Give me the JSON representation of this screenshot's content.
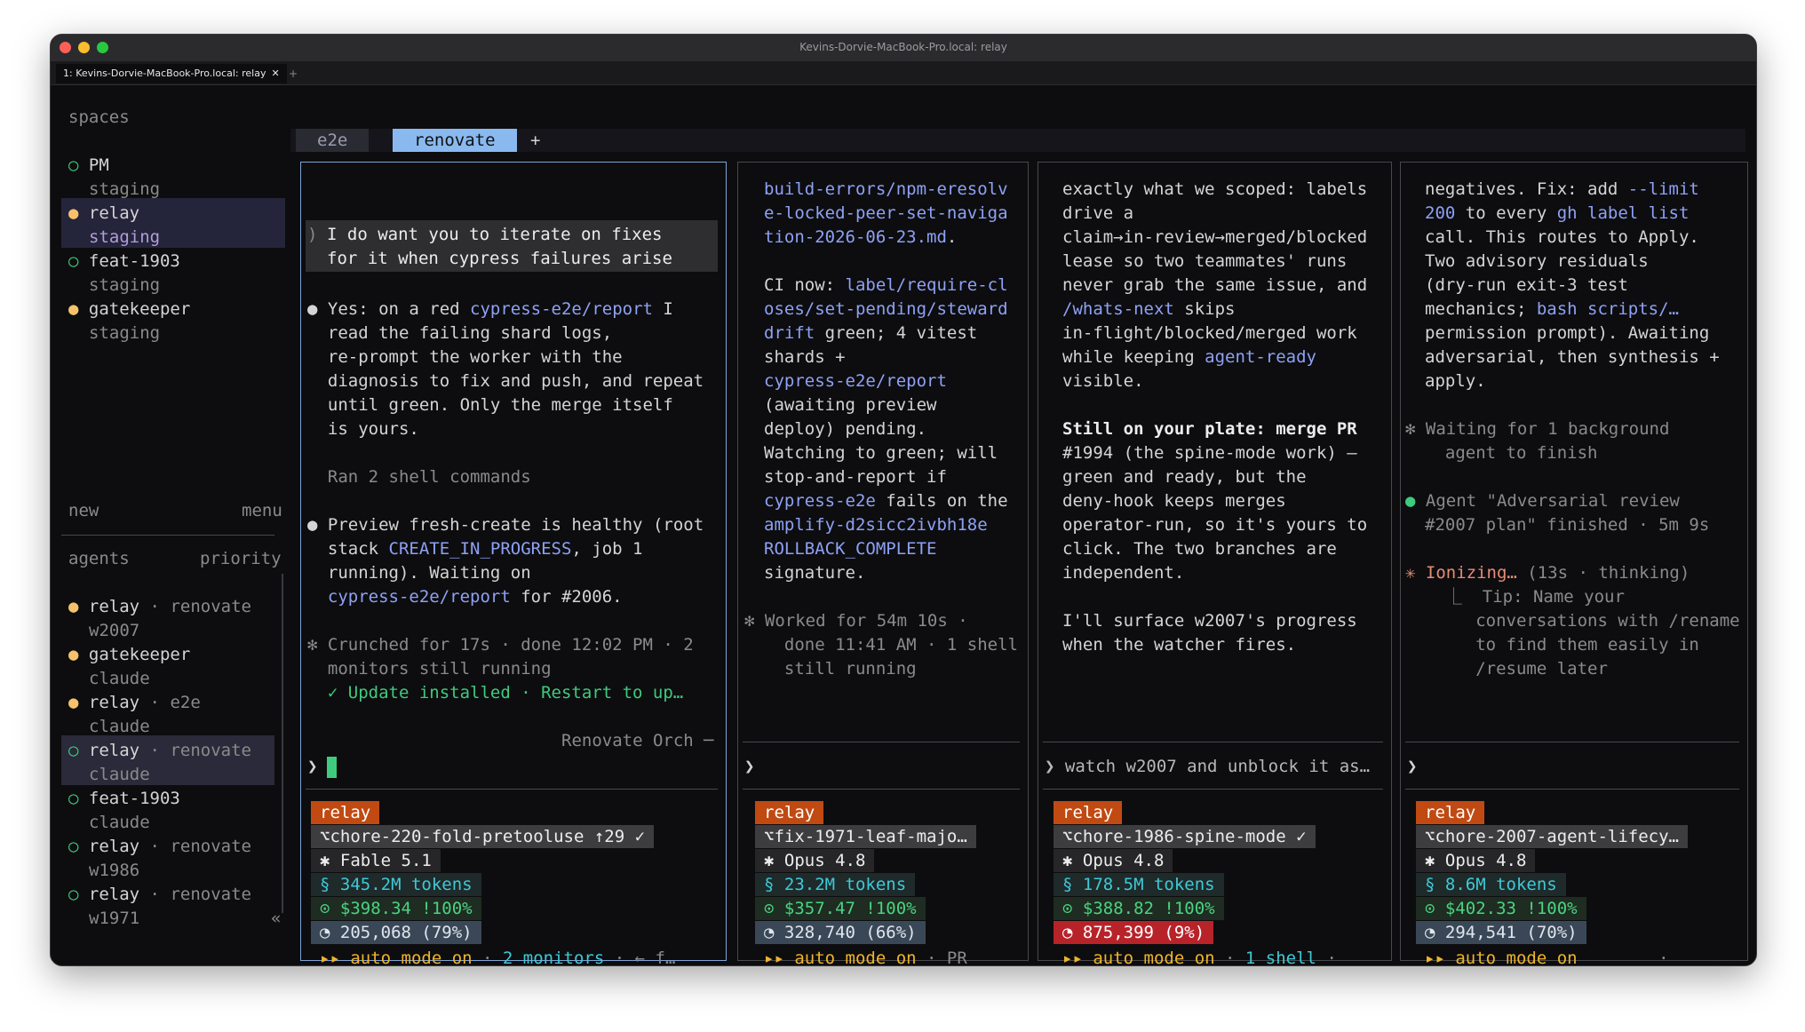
{
  "window": {
    "title": "Kevins-Dorvie-MacBook-Pro.local: relay"
  },
  "terminal_tab": {
    "label": "1: Kevins-Dorvie-MacBook-Pro.local: relay",
    "close": "✕",
    "new": "+"
  },
  "sidebar": {
    "spaces_header": "spaces",
    "spaces": [
      {
        "dot": "○",
        "name": "PM",
        "sub": "staging"
      },
      {
        "dot": "●",
        "name": "relay",
        "sub": "staging"
      },
      {
        "dot": "○",
        "name": "feat-1903",
        "sub": "staging"
      },
      {
        "dot": "●",
        "name": "gatekeeper",
        "sub": "staging"
      }
    ],
    "new_label": "new",
    "menu_label": "menu",
    "agents_header": "agents",
    "priority_label": "priority",
    "agents": [
      {
        "dot": "●",
        "name": "relay",
        "sep": " · ",
        "space": "renovate",
        "sub": "w2007"
      },
      {
        "dot": "●",
        "name": "gatekeeper",
        "sep": "",
        "space": "",
        "sub": "claude"
      },
      {
        "dot": "●",
        "name": "relay",
        "sep": " · ",
        "space": "e2e",
        "sub": "claude"
      },
      {
        "dot": "○",
        "name": "relay",
        "sep": " · ",
        "space": "renovate",
        "sub": "claude"
      },
      {
        "dot": "○",
        "name": "feat-1903",
        "sep": "",
        "space": "",
        "sub": "claude"
      },
      {
        "dot": "○",
        "name": "relay",
        "sep": " · ",
        "space": "renovate",
        "sub": "w1986"
      },
      {
        "dot": "○",
        "name": "relay",
        "sep": " · ",
        "space": "renovate",
        "sub": "w1971"
      }
    ],
    "collapse": "«"
  },
  "space_tabs": [
    {
      "label": "e2e"
    },
    {
      "label": "renovate"
    }
  ],
  "space_tab_add": "+",
  "panes": [
    {
      "lines": [
        [
          "",
          "",
          ""
        ],
        [
          "",
          ")",
          "dim"
        ],
        [
          "I do want you to iterate on fixes"
        ],
        [
          "for it when cypress failures arise"
        ]
      ],
      "body": [
        [
          {
            "t": "● ",
            "c": ""
          },
          {
            "t": "Yes: on a red ",
            "c": ""
          },
          {
            "t": "cypress-e2e/report",
            "c": "lnk"
          },
          {
            "t": " I",
            "c": ""
          }
        ],
        [
          {
            "t": "  read the failing shard logs,",
            "c": ""
          }
        ],
        [
          {
            "t": "  re-prompt the worker with the",
            "c": ""
          }
        ],
        [
          {
            "t": "  diagnosis to fix and push, and repeat",
            "c": ""
          }
        ],
        [
          {
            "t": "  until green. Only the merge itself",
            "c": ""
          }
        ],
        [
          {
            "t": "  is yours.",
            "c": ""
          }
        ],
        [
          {
            "t": "",
            "c": ""
          }
        ],
        [
          {
            "t": "  Ran 2 shell commands",
            "c": "dim"
          }
        ],
        [
          {
            "t": "",
            "c": ""
          }
        ],
        [
          {
            "t": "● ",
            "c": ""
          },
          {
            "t": "Preview fresh-create is healthy (root",
            "c": ""
          }
        ],
        [
          {
            "t": "  stack ",
            "c": ""
          },
          {
            "t": "CREATE_IN_PROGRESS",
            "c": "lnk"
          },
          {
            "t": ", job 1",
            "c": ""
          }
        ],
        [
          {
            "t": "  running). Waiting on",
            "c": ""
          }
        ],
        [
          {
            "t": "  ",
            "c": ""
          },
          {
            "t": "cypress-e2e/report",
            "c": "lnk"
          },
          {
            "t": " for #2006.",
            "c": ""
          }
        ],
        [
          {
            "t": "",
            "c": ""
          }
        ],
        [
          {
            "t": "✻ Crunched for 17s · done 12:02 PM · 2",
            "c": "dim"
          }
        ],
        [
          {
            "t": "  monitors still running",
            "c": "dim"
          }
        ],
        [
          {
            "t": "  ✓ Update installed · Restart to up…",
            "c": "grn"
          }
        ]
      ],
      "footer_label": "Renovate Orch ─",
      "prompt": "❯",
      "relay": "relay",
      "branch": "⌥chore-220-fold-pretooluse ↑29 ✓",
      "model": "✱ Fable 5.1",
      "tokens": "§ 345.2M tokens",
      "cost": "⊙ $398.34 !100%",
      "ctx": "◔ 205,068 (79%)",
      "status": [
        {
          "t": "▸▸ auto mode on",
          "c": "yel"
        },
        {
          "t": " · ",
          "c": "dim"
        },
        {
          "t": "2 monitors",
          "c": "cyan"
        },
        {
          "t": " · ← f…",
          "c": "dim"
        }
      ]
    },
    {
      "body": [
        [
          {
            "t": "build-errors/npm-eresolv",
            "c": "lnk"
          }
        ],
        [
          {
            "t": "e-locked-peer-set-naviga",
            "c": "lnk"
          }
        ],
        [
          {
            "t": "tion-2026-06-23.md",
            "c": "lnk"
          },
          {
            "t": ".",
            "c": ""
          }
        ],
        [
          {
            "t": "",
            "c": ""
          }
        ],
        [
          {
            "t": "CI now: ",
            "c": ""
          },
          {
            "t": "label/require-cl",
            "c": "lnk"
          }
        ],
        [
          {
            "t": "oses/set-pending/steward",
            "c": "lnk"
          }
        ],
        [
          {
            "t": "drift",
            "c": "lnk"
          },
          {
            "t": " green; 4 vitest",
            "c": ""
          }
        ],
        [
          {
            "t": "shards +",
            "c": ""
          }
        ],
        [
          {
            "t": "cypress-e2e/report",
            "c": "lnk"
          }
        ],
        [
          {
            "t": "(awaiting preview",
            "c": ""
          }
        ],
        [
          {
            "t": "deploy) pending.",
            "c": ""
          }
        ],
        [
          {
            "t": "Watching to green; will",
            "c": ""
          }
        ],
        [
          {
            "t": "stop-and-report if",
            "c": ""
          }
        ],
        [
          {
            "t": "cypress-e2e",
            "c": "lnk"
          },
          {
            "t": " fails on the",
            "c": ""
          }
        ],
        [
          {
            "t": "amplify-d2sicc2ivbh18e",
            "c": "lnk"
          }
        ],
        [
          {
            "t": "ROLLBACK_COMPLETE",
            "c": "lnk"
          }
        ],
        [
          {
            "t": "signature.",
            "c": ""
          }
        ],
        [
          {
            "t": "",
            "c": ""
          }
        ],
        [
          {
            "t": "✻ Worked for 54m 10s ·",
            "c": "dim"
          }
        ],
        [
          {
            "t": "  done 11:41 AM · 1 shell",
            "c": "dim"
          }
        ],
        [
          {
            "t": "  still running",
            "c": "dim"
          }
        ]
      ],
      "prompt": "❯",
      "relay": "relay",
      "branch": "⌥fix-1971-leaf-majo…",
      "model": "✱ Opus 4.8",
      "tokens": "§ 23.2M tokens",
      "cost": "⊙ $357.47 !100%",
      "ctx": "◔ 328,740 (66%)",
      "status": [
        {
          "t": "▸▸ auto mode on",
          "c": "yel"
        },
        {
          "t": " · PR",
          "c": "dim"
        }
      ]
    },
    {
      "body": [
        [
          {
            "t": "exactly what we scoped: labels",
            "c": ""
          }
        ],
        [
          {
            "t": "drive a",
            "c": ""
          }
        ],
        [
          {
            "t": "claim→in-review→merged/blocked",
            "c": ""
          }
        ],
        [
          {
            "t": "lease so two teammates' runs",
            "c": ""
          }
        ],
        [
          {
            "t": "never grab the same issue, and",
            "c": ""
          }
        ],
        [
          {
            "t": "/whats-next",
            "c": "lnk"
          },
          {
            "t": " skips",
            "c": ""
          }
        ],
        [
          {
            "t": "in-flight/blocked/merged work",
            "c": ""
          }
        ],
        [
          {
            "t": "while keeping ",
            "c": ""
          },
          {
            "t": "agent-ready",
            "c": "lnk"
          }
        ],
        [
          {
            "t": "visible.",
            "c": ""
          }
        ],
        [
          {
            "t": "",
            "c": ""
          }
        ],
        [
          {
            "t": "Still on your plate:",
            "c": "bold"
          },
          {
            "t": " merge PR",
            "c": "bold"
          }
        ],
        [
          {
            "t": "#1994 (the spine-mode work) —",
            "c": ""
          }
        ],
        [
          {
            "t": "green and ready, but the",
            "c": ""
          }
        ],
        [
          {
            "t": "deny-hook keeps merges",
            "c": ""
          }
        ],
        [
          {
            "t": "operator-run, so it's yours to",
            "c": ""
          }
        ],
        [
          {
            "t": "click. The two branches are",
            "c": ""
          }
        ],
        [
          {
            "t": "independent.",
            "c": ""
          }
        ],
        [
          {
            "t": "",
            "c": ""
          }
        ],
        [
          {
            "t": "I'll surface w2007's progress",
            "c": ""
          }
        ],
        [
          {
            "t": "when the watcher fires.",
            "c": ""
          }
        ]
      ],
      "prompt": "❯ watch w2007 and unblock it as…",
      "relay": "relay",
      "branch": "⌥chore-1986-spine-mode ✓",
      "model": "✱ Opus 4.8",
      "tokens": "§ 178.5M tokens",
      "cost": "⊙ $388.82 !100%",
      "ctx": "◔ 875,399 (9%)",
      "status": [
        {
          "t": "▸▸ auto mode on",
          "c": "yel"
        },
        {
          "t": " · ",
          "c": "dim"
        },
        {
          "t": "1 shell",
          "c": "cyan"
        },
        {
          "t": " ·",
          "c": "dim"
        }
      ]
    },
    {
      "body": [
        [
          {
            "t": "negatives. Fix: add ",
            "c": ""
          },
          {
            "t": "--limit",
            "c": "lnk"
          }
        ],
        [
          {
            "t": "200",
            "c": "lnk"
          },
          {
            "t": " to every ",
            "c": ""
          },
          {
            "t": "gh label list",
            "c": "lnk"
          }
        ],
        [
          {
            "t": "call. This routes to Apply.",
            "c": ""
          }
        ],
        [
          {
            "t": "Two advisory residuals",
            "c": ""
          }
        ],
        [
          {
            "t": "(dry-run exit-3 test",
            "c": ""
          }
        ],
        [
          {
            "t": "mechanics; ",
            "c": ""
          },
          {
            "t": "bash scripts/…",
            "c": "lnk"
          }
        ],
        [
          {
            "t": "permission prompt). Awaiting",
            "c": ""
          }
        ],
        [
          {
            "t": "adversarial, then synthesis +",
            "c": ""
          }
        ],
        [
          {
            "t": "apply.",
            "c": ""
          }
        ],
        [
          {
            "t": "",
            "c": ""
          }
        ],
        [
          {
            "t": "✻ Waiting for 1 background",
            "c": "dim"
          }
        ],
        [
          {
            "t": "  agent to finish",
            "c": "dim"
          }
        ],
        [
          {
            "t": "",
            "c": ""
          }
        ],
        [
          {
            "t": "● ",
            "c": "grn"
          },
          {
            "t": "Agent \"Adversarial review",
            "c": "dim"
          }
        ],
        [
          {
            "t": "#2007 plan\" finished · 5m 9s",
            "c": "dim"
          }
        ],
        [
          {
            "t": "",
            "c": ""
          }
        ],
        [
          {
            "t": "✳ Ionizing… ",
            "c": "pink"
          },
          {
            "t": "(13s · thinking)",
            "c": "dim"
          }
        ],
        [
          {
            "t": "  ⎿  Tip: Name your",
            "c": "dim"
          }
        ],
        [
          {
            "t": "     conversations with /rename",
            "c": "dim"
          }
        ],
        [
          {
            "t": "     to find them easily in",
            "c": "dim"
          }
        ],
        [
          {
            "t": "     /resume later",
            "c": "dim"
          }
        ]
      ],
      "prompt": "❯",
      "relay": "relay",
      "branch": "⌥chore-2007-agent-lifecy…",
      "model": "✱ Opus 4.8",
      "tokens": "§ 8.6M tokens",
      "cost": "⊙ $402.33 !100%",
      "ctx": "◔ 294,541 (70%)",
      "status": [
        {
          "t": "▸▸ auto mode on",
          "c": "yel"
        },
        {
          "t": "        ·",
          "c": "dim"
        }
      ]
    }
  ],
  "colors": {
    "accent_tab": "#89b9ef",
    "relay_tag": "#c04a12",
    "ctx_warn": "#b8232a",
    "green": "#3ecb7e",
    "link": "#8ea1f5"
  }
}
